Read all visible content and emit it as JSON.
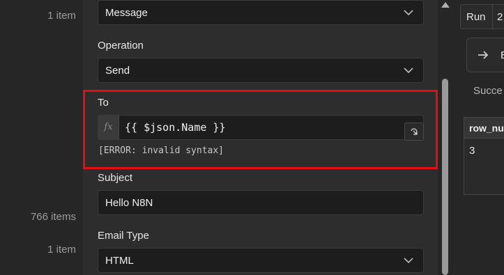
{
  "left_column": {
    "counts": [
      "1 item",
      "766 items",
      "1 item"
    ]
  },
  "fields": {
    "resource": {
      "value": "Message"
    },
    "operation": {
      "label": "Operation",
      "value": "Send"
    },
    "to": {
      "label": "To",
      "expression": "{{ $json.Name }}",
      "fx_label": "fx",
      "error": "[ERROR: invalid syntax]"
    },
    "subject": {
      "label": "Subject",
      "value": "Hello N8N"
    },
    "email_type": {
      "label": "Email Type",
      "value": "HTML"
    }
  },
  "right_panel": {
    "run_label": "Run",
    "run_number": "2",
    "branch_label": "B",
    "status_text": "Succe",
    "table": {
      "headers": [
        "row_nu"
      ],
      "rows": [
        [
          "3"
        ]
      ]
    }
  },
  "colors": {
    "highlight": "#e10f12",
    "panel_bg": "#2d2d2d",
    "input_bg": "#1d1d1d"
  },
  "icons": {
    "chevron": "chevron-down-icon",
    "expand": "expand-icon",
    "arrow": "arrow-right-icon",
    "scroll_up": "scroll-up-icon"
  }
}
